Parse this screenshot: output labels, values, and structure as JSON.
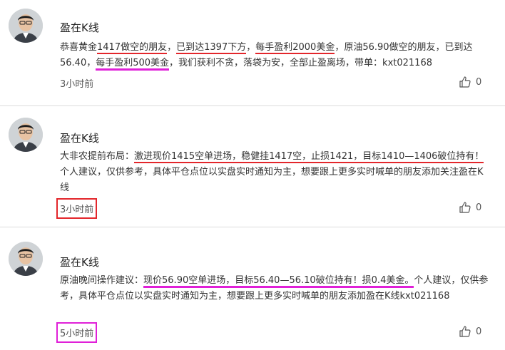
{
  "posts": [
    {
      "author": "盈在K线",
      "segments": [
        {
          "text": "恭喜黄金",
          "u": ""
        },
        {
          "text": "1417做空的朋友",
          "u": "red"
        },
        {
          "text": "，",
          "u": ""
        },
        {
          "text": "已到达1397下方",
          "u": "red"
        },
        {
          "text": "，",
          "u": ""
        },
        {
          "text": "每手盈利2000美金",
          "u": "red"
        },
        {
          "text": "，原油56.90做空的朋友，已到达56.40，",
          "u": ""
        },
        {
          "text": "每手盈利500美金",
          "u": "mag"
        },
        {
          "text": "，我们获利不贪，落袋为安，全部止盈离场，带单：kxt021168",
          "u": ""
        }
      ],
      "time": "3小时前",
      "likes": "0"
    },
    {
      "author": "盈在K线",
      "segments": [
        {
          "text": "大非农提前布局：",
          "u": ""
        },
        {
          "text": "激进现价1415空单进场，稳健挂1417空，止损1421，目标1410—1406破位持有！",
          "u": "red"
        },
        {
          "text": "个人建议，仅供参考，具体平仓点位以实盘实时通知为主，想要跟上更多实时喊单的朋友添加关注盈在K线",
          "u": ""
        }
      ],
      "time": "3小时前",
      "likes": "0"
    },
    {
      "author": "盈在K线",
      "segments": [
        {
          "text": "原油晚间操作建议：",
          "u": ""
        },
        {
          "text": "现价56.90空单进场，目标56.40—56.10破位持有！损0.4美金。",
          "u": "mag"
        },
        {
          "text": "个人建议，仅供参考，具体平仓点位以实盘实时通知为主，想要跟上更多实时喊单的朋友添加盈在K线kxt021168",
          "u": ""
        }
      ],
      "time": "5小时前",
      "likes": "0"
    }
  ],
  "highlight_colors": {
    "red": "#e3262b",
    "magenta": "#e020d8"
  },
  "icons": {
    "avatar": "avatar-photo",
    "like": "thumbs-up-icon"
  }
}
